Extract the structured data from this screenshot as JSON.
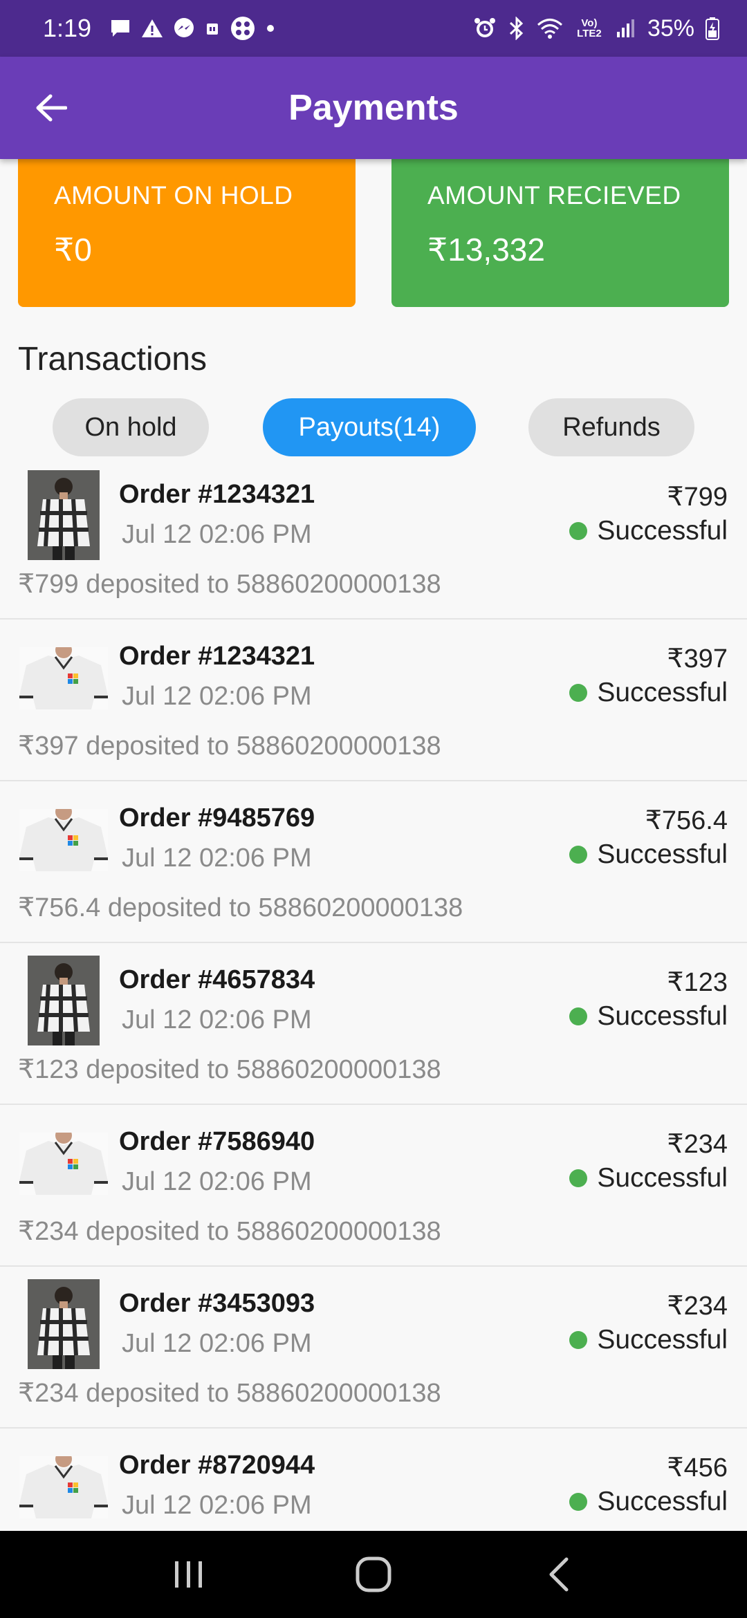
{
  "status_bar": {
    "time": "1:19",
    "battery": "35%",
    "network": "Vo) LTE2",
    "left_icons": [
      "chat-icon",
      "warning-icon",
      "messenger-icon",
      "sim-icon",
      "app-icon",
      "dot-icon"
    ],
    "right_icons": [
      "alarm-icon",
      "bluetooth-icon",
      "wifi-icon",
      "signal-icon",
      "battery-icon"
    ]
  },
  "app_bar": {
    "title": "Payments",
    "back_icon": "arrow-left-icon"
  },
  "cards": {
    "hold": {
      "label": "AMOUNT ON HOLD",
      "value": "₹0",
      "color": "#ff9800"
    },
    "received": {
      "label": "AMOUNT RECIEVED",
      "value": "₹13,332",
      "color": "#4caf50"
    }
  },
  "transactions": {
    "heading": "Transactions",
    "tabs": [
      {
        "label": "On hold",
        "active": false
      },
      {
        "label": "Payouts(14)",
        "active": true
      },
      {
        "label": "Refunds",
        "active": false
      }
    ],
    "items": [
      {
        "order": "Order #1234321",
        "date": "Jul 12 02:06 PM",
        "amount": "₹799",
        "status": "Successful",
        "deposit": "₹799 deposited to 58860200000138",
        "thumb": "checked-shirt"
      },
      {
        "order": "Order #1234321",
        "date": "Jul 12 02:06 PM",
        "amount": "₹397",
        "status": "Successful",
        "deposit": "₹397 deposited to 58860200000138",
        "thumb": "white-polo"
      },
      {
        "order": "Order #9485769",
        "date": "Jul 12 02:06 PM",
        "amount": "₹756.4",
        "status": "Successful",
        "deposit": "₹756.4 deposited to 58860200000138",
        "thumb": "white-polo"
      },
      {
        "order": "Order #4657834",
        "date": "Jul 12 02:06 PM",
        "amount": "₹123",
        "status": "Successful",
        "deposit": "₹123 deposited to 58860200000138",
        "thumb": "checked-shirt"
      },
      {
        "order": "Order #7586940",
        "date": "Jul 12 02:06 PM",
        "amount": "₹234",
        "status": "Successful",
        "deposit": "₹234 deposited to 58860200000138",
        "thumb": "white-polo"
      },
      {
        "order": "Order #3453093",
        "date": "Jul 12 02:06 PM",
        "amount": "₹234",
        "status": "Successful",
        "deposit": "₹234 deposited to 58860200000138",
        "thumb": "checked-shirt"
      },
      {
        "order": "Order #8720944",
        "date": "Jul 12 02:06 PM",
        "amount": "₹456",
        "status": "Successful",
        "deposit": "",
        "thumb": "white-polo"
      }
    ]
  },
  "nav_bar": {
    "icons": [
      "recent-apps-icon",
      "home-icon",
      "back-icon"
    ]
  }
}
